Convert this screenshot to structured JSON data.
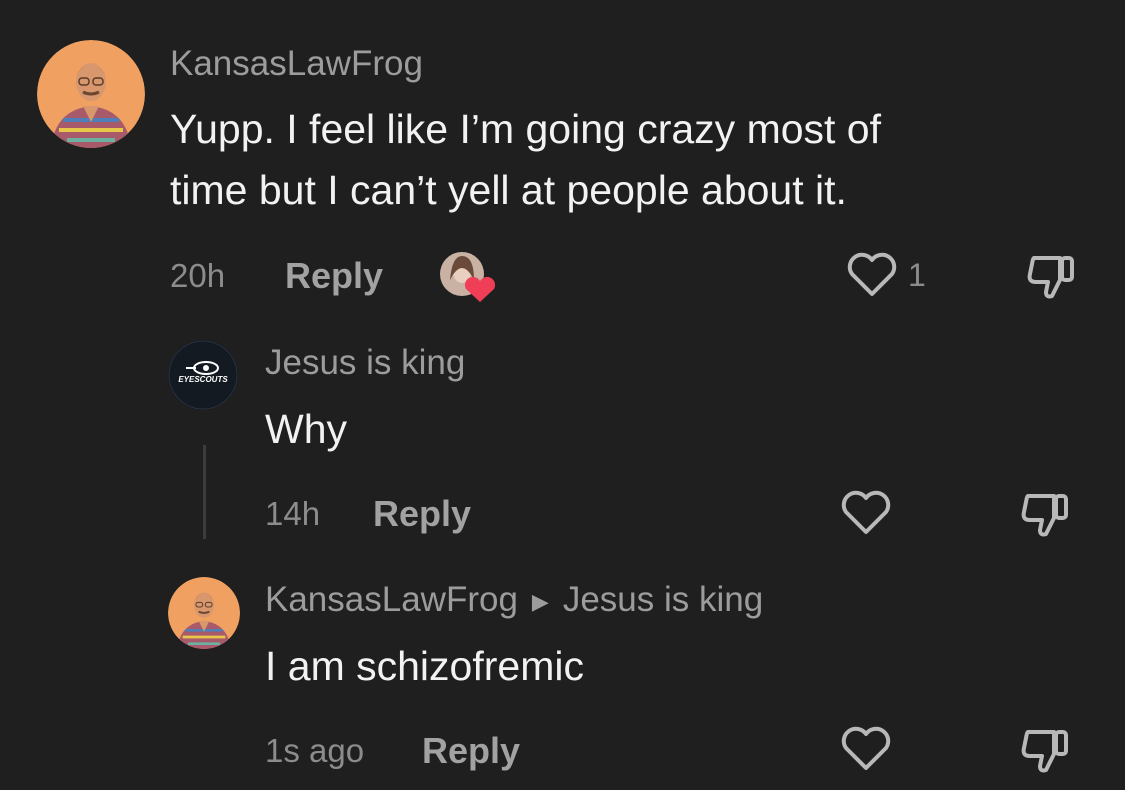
{
  "comments": [
    {
      "username": "KansasLawFrog",
      "text_line1": "Yupp. I feel like I’m going crazy most of",
      "text_line2": "time but I can’t yell at people about it.",
      "time": "20h",
      "reply_label": "Reply",
      "like_count": "1"
    },
    {
      "username": "Jesus is king",
      "avatar_text": "EYESCOUTS",
      "text": "Why",
      "time": "14h",
      "reply_label": "Reply"
    },
    {
      "username": "KansasLawFrog",
      "reply_to": "Jesus is king",
      "text": "I am schizofremic",
      "time": "1s ago",
      "reply_label": "Reply"
    }
  ],
  "colors": {
    "background": "#1f1f1f",
    "heart_badge": "#ef3e55",
    "avatar_orange": "#f0a060"
  },
  "icons": [
    "heart-outline-icon",
    "thumbs-down-icon",
    "creator-liked-badge",
    "reply-arrow-icon"
  ]
}
